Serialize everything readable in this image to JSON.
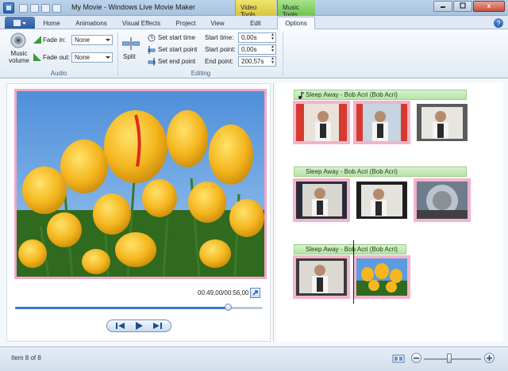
{
  "window": {
    "title": "My Movie - Windows Live Movie Maker",
    "context_video": "Video Tools",
    "context_music": "Music Tools",
    "close_label": "x"
  },
  "tabs": [
    {
      "label": "Home"
    },
    {
      "label": "Animations"
    },
    {
      "label": "Visual Effects"
    },
    {
      "label": "Project"
    },
    {
      "label": "View"
    },
    {
      "label": "Edit"
    },
    {
      "label": "Options",
      "active": true
    }
  ],
  "ribbon": {
    "audio": {
      "music_volume_label": "Music volume",
      "fade_in_label": "Fade in:",
      "fade_in_value": "None",
      "fade_out_label": "Fade out:",
      "fade_out_value": "None",
      "group_label": "Audio"
    },
    "editing": {
      "split_label": "Split",
      "set_start_time": "Set start time",
      "set_start_point": "Set start point",
      "set_end_point": "Set end point",
      "start_time_label": "Start time:",
      "start_time_value": "0,00s",
      "start_point_label": "Start point:",
      "start_point_value": "0,00s",
      "end_point_label": "End point:",
      "end_point_value": "200,57s",
      "group_label": "Editing"
    }
  },
  "preview": {
    "time": "00:49,00/00:56,00",
    "seek_progress": 0.86
  },
  "storyboard": {
    "music_title": "Sleep Away - Bob Acri (Bob Acri)"
  },
  "status": {
    "item_text": "Item 8 of 8",
    "zoom_level": 0.45
  },
  "colors": {
    "selection": "#efa9c7",
    "music_bar": "#b7e4a8",
    "video_tools": "#d6c43c",
    "music_tools": "#6ec34e"
  }
}
